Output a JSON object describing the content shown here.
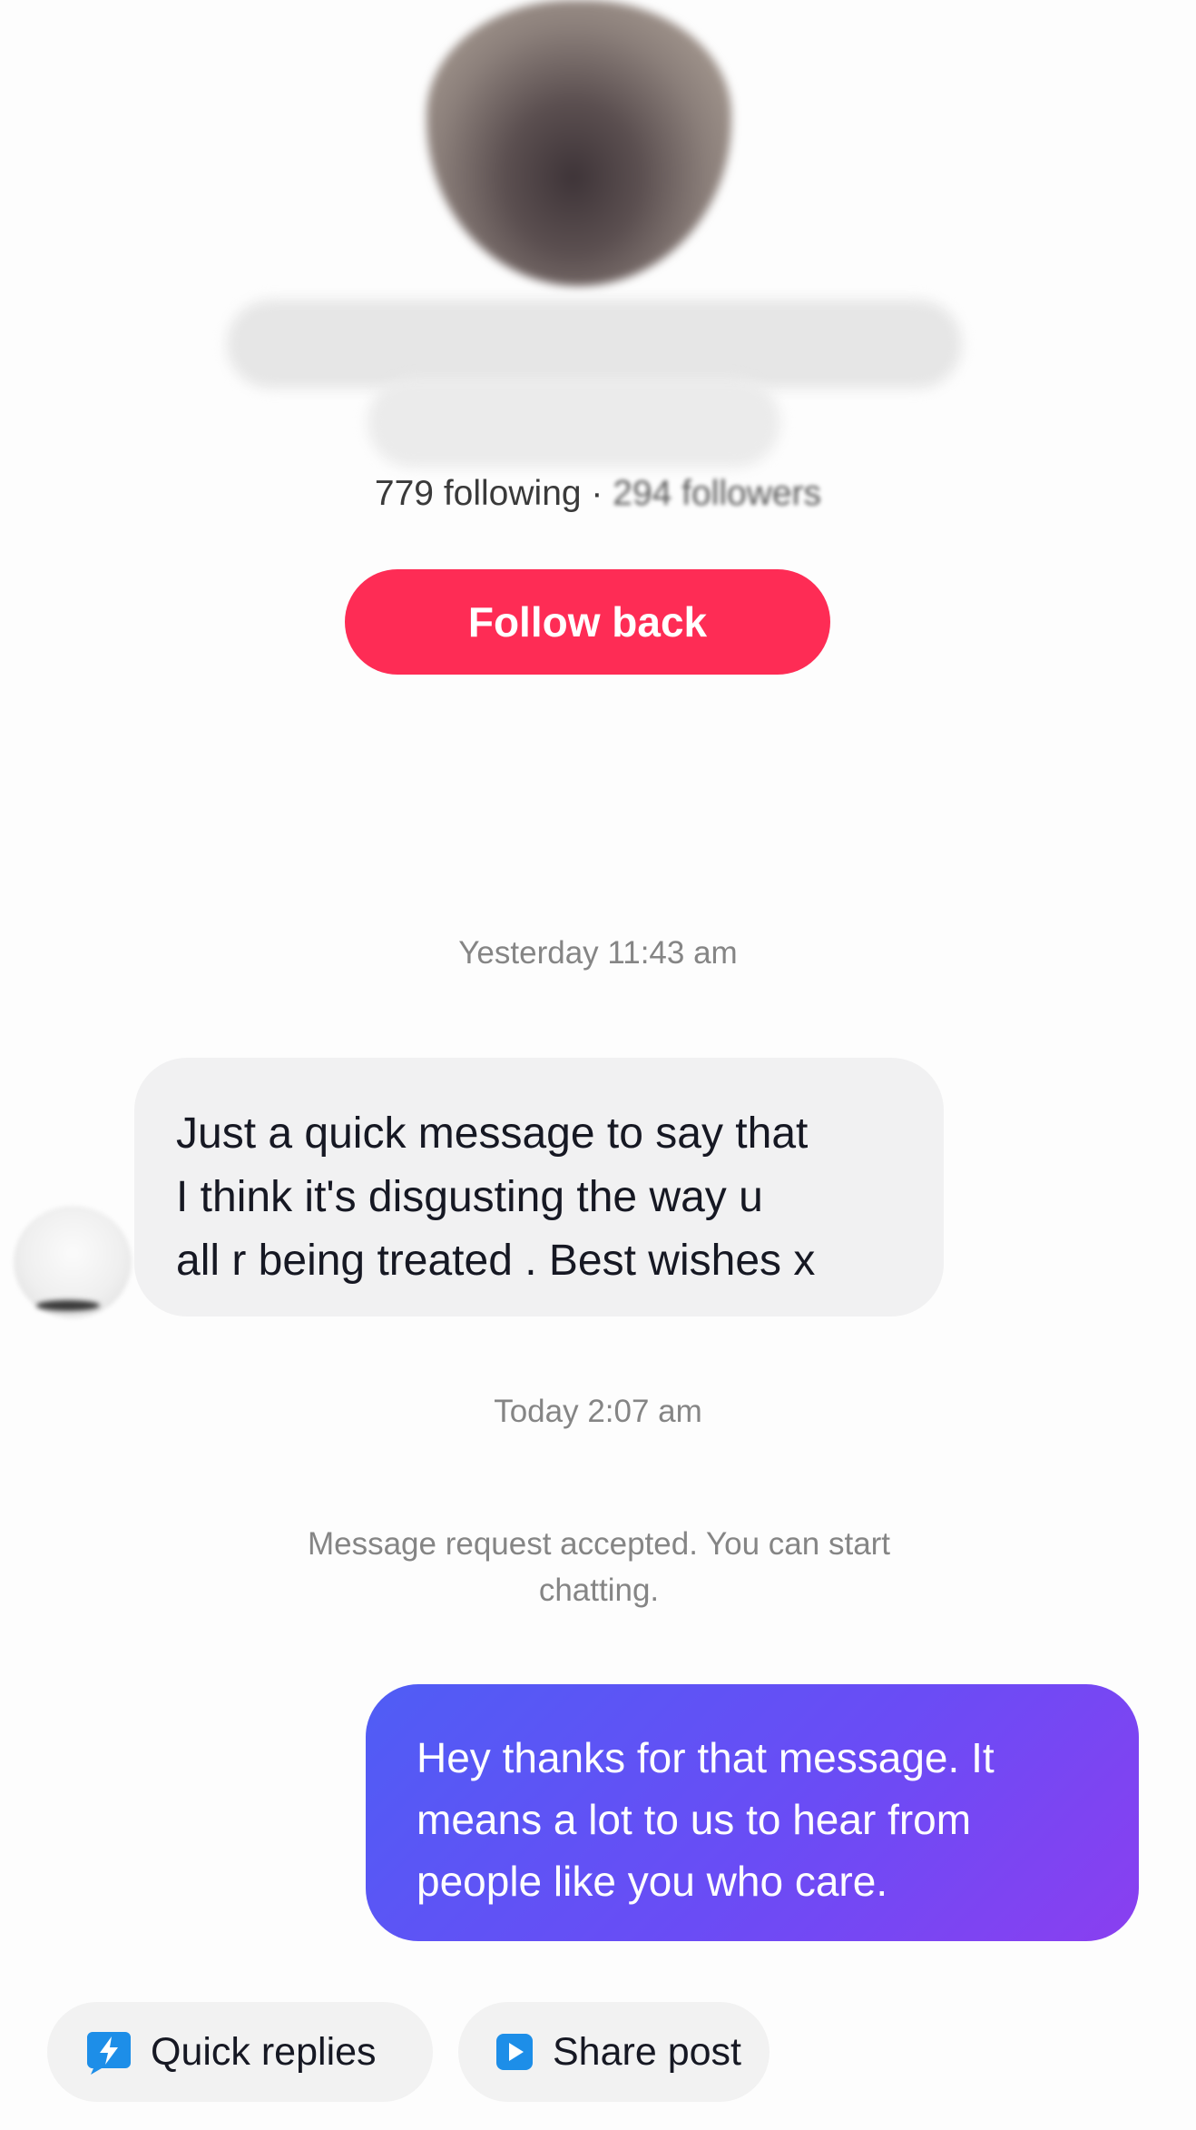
{
  "profile": {
    "following_text": "779 following",
    "separator": " · ",
    "followers_text": "294 followers",
    "follow_back_label": "Follow back"
  },
  "conversation": {
    "timestamp_1": "Yesterday 11:43 am",
    "incoming_message": {
      "lines": [
        "Just a quick message to say that",
        "I think it's disgusting the way u",
        "all r being treated . Best wishes x"
      ]
    },
    "timestamp_2": "Today 2:07 am",
    "system_message": {
      "lines": [
        "Message request accepted. You can start",
        "chatting."
      ]
    },
    "outgoing_message": {
      "lines": [
        "Hey thanks for that message. It",
        "means a lot to us to hear from",
        "people like you who care."
      ]
    }
  },
  "actions": {
    "quick_replies_label": "Quick replies",
    "share_post_label": "Share post"
  },
  "colors": {
    "follow_button": "#fe2c55",
    "outgoing_bubble_start": "#4f5df5",
    "outgoing_bubble_end": "#8a3ff0",
    "incoming_bubble": "#f1f1f2",
    "action_icon": "#1d8ee8"
  },
  "icons": {
    "quick_replies": "lightning-bolt-icon",
    "share_post": "play-triangle-icon"
  }
}
